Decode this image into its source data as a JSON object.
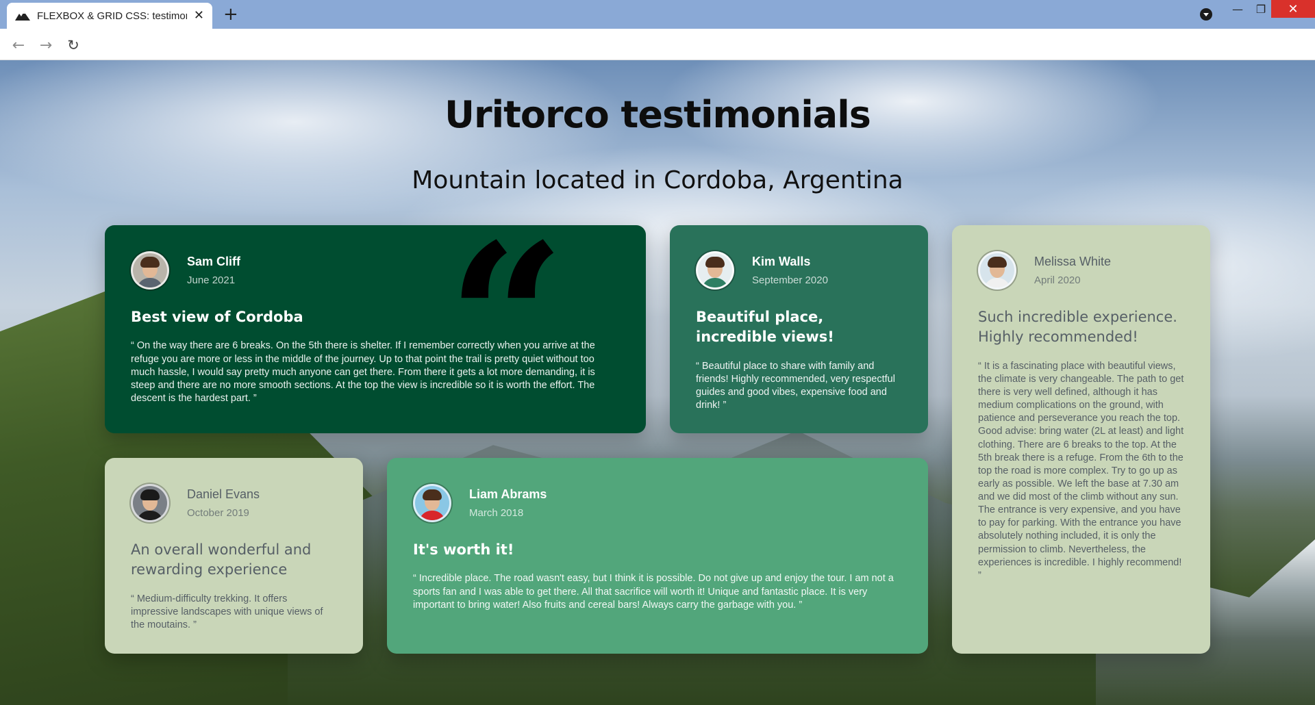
{
  "browser": {
    "tab_title": "FLEXBOX & GRID CSS: testimonia",
    "tab_close": "✕",
    "new_tab": "+",
    "minimize": "—",
    "maximize": "❐",
    "close": "✕",
    "back": "←",
    "forward": "→",
    "reload": "↻"
  },
  "page": {
    "title": "Uritorco testimonials",
    "subtitle": "Mountain located in Cordoba, Argentina"
  },
  "testimonials": [
    {
      "name": "Sam Cliff",
      "date": "June 2021",
      "heading": "Best view of Cordoba",
      "text": "“ On the way there are 6 breaks. On the 5th there is shelter. If I remember correctly when you arrive at the refuge you are more or less in the middle of the journey. Up to that point the trail is pretty quiet without too much hassle, I would say pretty much anyone can get there. From there it gets a lot more demanding, it is steep and there are no more smooth sections. At the top the view is incredible so it is worth the effort. The descent is the hardest part. ”",
      "quote_mark": "“"
    },
    {
      "name": "Kim Walls",
      "date": "September 2020",
      "heading": "Beautiful place, incredible views!",
      "text": "“ Beautiful place to share with family and friends! Highly recommended, very respectful guides and good vibes, expensive food and drink! ”"
    },
    {
      "name": "Melissa White",
      "date": "April 2020",
      "heading": "Such incredible experience. Highly recommended!",
      "text": "“ It is a fascinating place with beautiful views, the climate is very changeable. The path to get there is very well defined, although it has medium complications on the ground, with patience and perseverance you reach the top. Good advise: bring water (2L at least) and light clothing. There are 6 breaks to the top. At the 5th break there is a refuge. From the 6th to the top the road is more complex. Try to go up as early as possible. We left the base at 7.30 am and we did most of the climb without any sun. The entrance is very expensive, and you have to pay for parking. With the entrance you have absolutely nothing included, it is only the permission to climb. Nevertheless, the experiences is incredible. I highly recommend! ”"
    },
    {
      "name": "Daniel Evans",
      "date": "October 2019",
      "heading": "An overall wonderful and rewarding experience",
      "text": "“ Medium-difficulty trekking. It offers impressive landscapes with unique views of the moutains. ”"
    },
    {
      "name": "Liam Abrams",
      "date": "March 2018",
      "heading": "It's worth it!",
      "text": "“ Incredible place. The road wasn't easy, but I think it is possible. Do not give up and enjoy the tour. I am not a sports fan and I was able to get there. All that sacrifice will worth it! Unique and fantastic place. It is very important to bring water! Also fruits and cereal bars! Always carry the garbage with you. ”"
    }
  ]
}
